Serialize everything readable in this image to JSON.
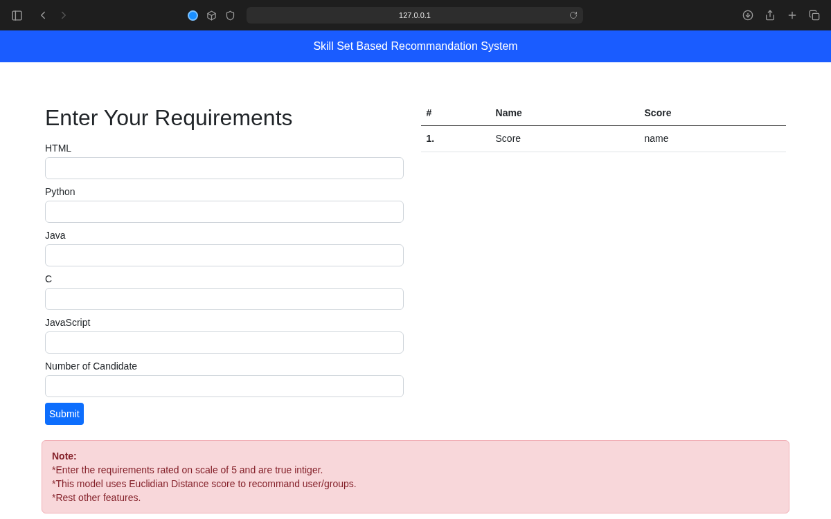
{
  "browser": {
    "address": "127.0.0.1"
  },
  "navbar": {
    "title": "Skill Set Based Recommandation System"
  },
  "form": {
    "heading": "Enter Your Requirements",
    "fields": [
      {
        "label": "HTML"
      },
      {
        "label": "Python"
      },
      {
        "label": "Java"
      },
      {
        "label": "C"
      },
      {
        "label": "JavaScript"
      },
      {
        "label": "Number of Candidate"
      }
    ],
    "submit": "Submit"
  },
  "table": {
    "columns": [
      "#",
      "Name",
      "Score"
    ],
    "rows": [
      [
        "1.",
        "Score",
        "name"
      ]
    ]
  },
  "note": {
    "title": "Note:",
    "lines": [
      "*Enter the requirements rated on scale of 5 and are true intiger.",
      "*This model uses Euclidian Distance score to recommand user/groups.",
      "*Rest other features."
    ]
  }
}
